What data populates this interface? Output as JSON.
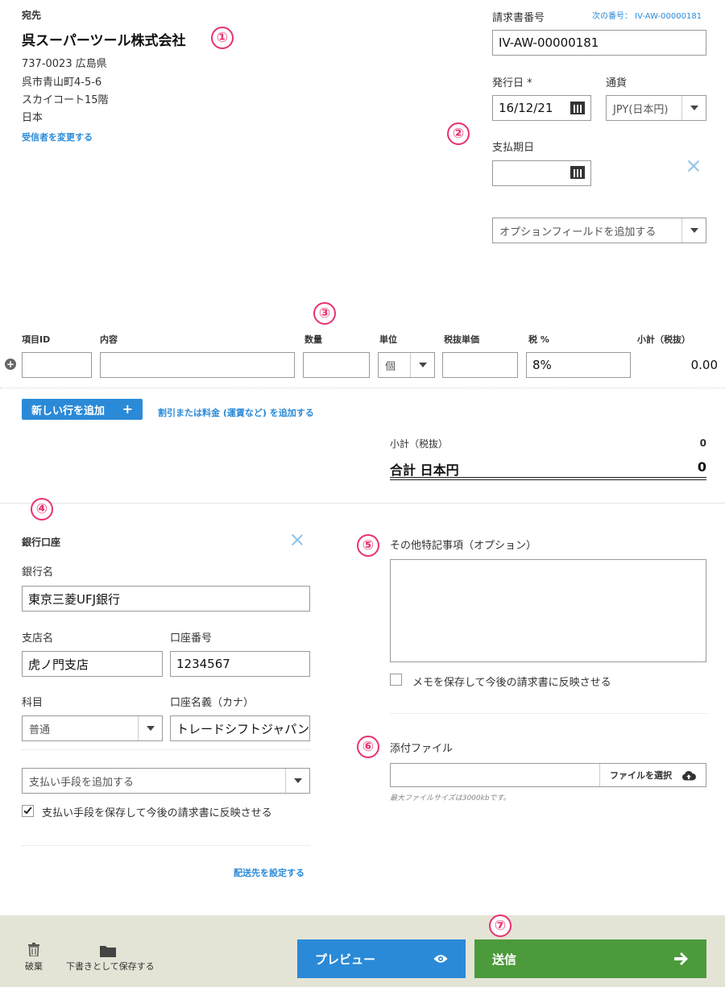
{
  "recipient": {
    "heading": "宛先",
    "company": "呉スーパーツール株式会社",
    "address_line1": "737-0023 広島県",
    "address_line2": "呉市青山町4-5-6",
    "address_line3": "スカイコート15階",
    "country": "日本",
    "change_link": "受信者を変更する"
  },
  "invoice_meta": {
    "number_label": "請求書番号",
    "next_number": "次の番号： IV-AW-00000181",
    "number_value": "IV-AW-00000181",
    "issue_date_label": "発行日 *",
    "issue_date_value": "16/12/21",
    "currency_label": "通貨",
    "currency_value": "JPY(日本円)",
    "due_date_label": "支払期日",
    "due_date_value": "",
    "optional_field": "オプションフィールドを追加する"
  },
  "line_items": {
    "headers": {
      "item_id": "項目ID",
      "description": "内容",
      "quantity": "数量",
      "unit": "単位",
      "unit_price": "税抜単価",
      "tax": "税 %",
      "subtotal": "小計（税抜）"
    },
    "row": {
      "item_id": "",
      "description": "",
      "quantity": "",
      "unit": "個",
      "unit_price": "",
      "tax": "8%",
      "subtotal": "0.00"
    },
    "add_row_button": "新しい行を追加",
    "add_discount_link": "割引または料金 (運賃など) を追加する"
  },
  "totals": {
    "subtotal_label": "小計（税抜）",
    "subtotal_value": "0",
    "total_label": "合計 日本円",
    "total_value": "0"
  },
  "bank": {
    "heading": "銀行口座",
    "bank_name_label": "銀行名",
    "bank_name_value": "東京三菱UFJ銀行",
    "branch_label": "支店名",
    "branch_value": "虎ノ門支店",
    "account_number_label": "口座番号",
    "account_number_value": "1234567",
    "type_label": "科目",
    "type_value": "普通",
    "holder_label": "口座名義（カナ）",
    "holder_value": "トレードシフトジャパン",
    "add_payment_method": "支払い手段を追加する",
    "save_payment_checkbox": "支払い手段を保存して今後の請求書に反映させる",
    "shipping_link": "配送先を設定する"
  },
  "notes": {
    "label": "その他特記事項（オプション）",
    "value": "",
    "save_checkbox": "メモを保存して今後の請求書に反映させる"
  },
  "attachment": {
    "label": "添付ファイル",
    "button": "ファイルを選択",
    "hint": "最大ファイルサイズは3000kbです。"
  },
  "footer": {
    "discard": "破棄",
    "save_draft": "下書きとして保存する",
    "preview": "プレビュー",
    "send": "送信"
  },
  "markers": [
    "①",
    "②",
    "③",
    "④",
    "⑤",
    "⑥",
    "⑦"
  ],
  "colors": {
    "link": "#2a8ad8",
    "add_row_button": "#2a8ad8",
    "preview_button": "#2a8ad8",
    "send_button": "#4c9a3b",
    "marker": "#e8326e",
    "footer_bg": "#e4e4d6"
  }
}
